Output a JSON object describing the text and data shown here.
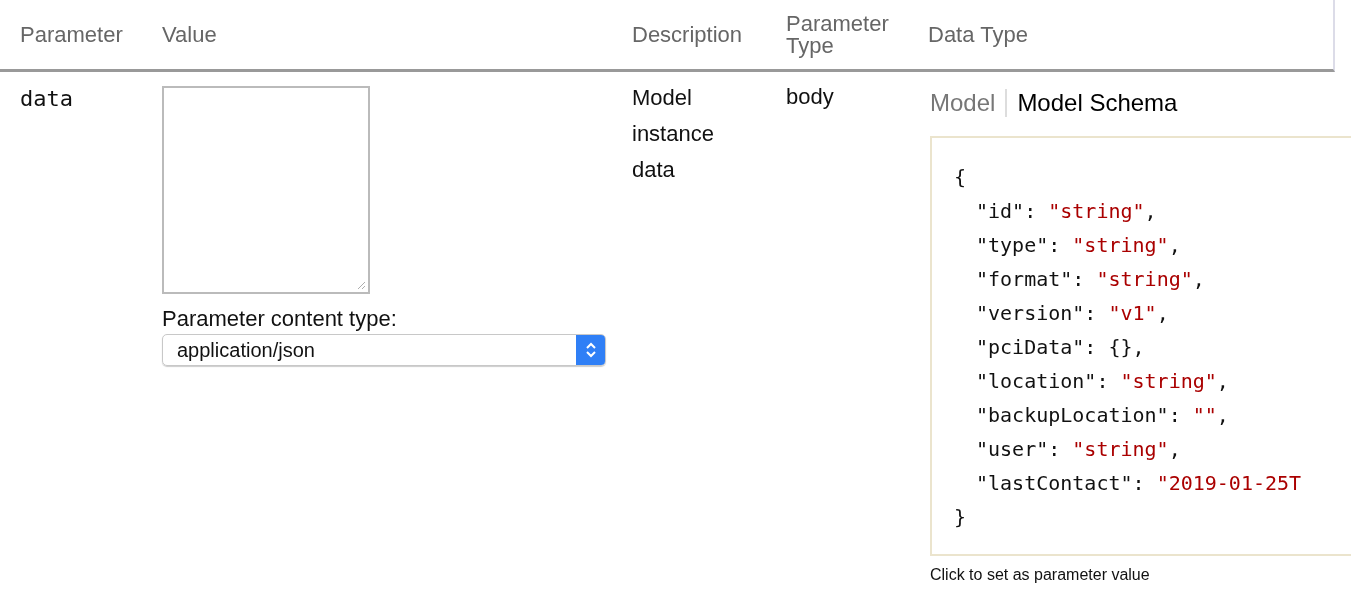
{
  "table": {
    "columns": [
      "Parameter",
      "Value",
      "Description",
      "Parameter Type",
      "Data Type"
    ],
    "rows": [
      {
        "parameter": "data",
        "value_label": "Parameter content type:",
        "content_type": "application/json",
        "description": "Model instance data",
        "parameter_type": "body",
        "data_type": {
          "tabs": [
            {
              "label": "Model",
              "selected": false
            },
            {
              "label": "Model Schema",
              "selected": true
            }
          ],
          "schema": {
            "open": "{",
            "close": "}",
            "lines": [
              {
                "kind": "string",
                "key": "\"id\": ",
                "value": "\"string\"",
                "trail": ","
              },
              {
                "kind": "string",
                "key": "\"type\": ",
                "value": "\"string\"",
                "trail": ","
              },
              {
                "kind": "string",
                "key": "\"format\": ",
                "value": "\"string\"",
                "trail": ","
              },
              {
                "kind": "string",
                "key": "\"version\": ",
                "value": "\"v1\"",
                "trail": ","
              },
              {
                "kind": "plain",
                "key": "\"pciData\": ",
                "value": "{}",
                "trail": ","
              },
              {
                "kind": "string",
                "key": "\"location\": ",
                "value": "\"string\"",
                "trail": ","
              },
              {
                "kind": "string",
                "key": "\"backupLocation\": ",
                "value": "\"\"",
                "trail": ","
              },
              {
                "kind": "string",
                "key": "\"user\": ",
                "value": "\"string\"",
                "trail": ","
              },
              {
                "kind": "string",
                "key": "\"lastContact\": ",
                "value": "\"2019-01-25T"
              }
            ]
          },
          "hint": "Click to set as parameter value"
        }
      }
    ]
  }
}
